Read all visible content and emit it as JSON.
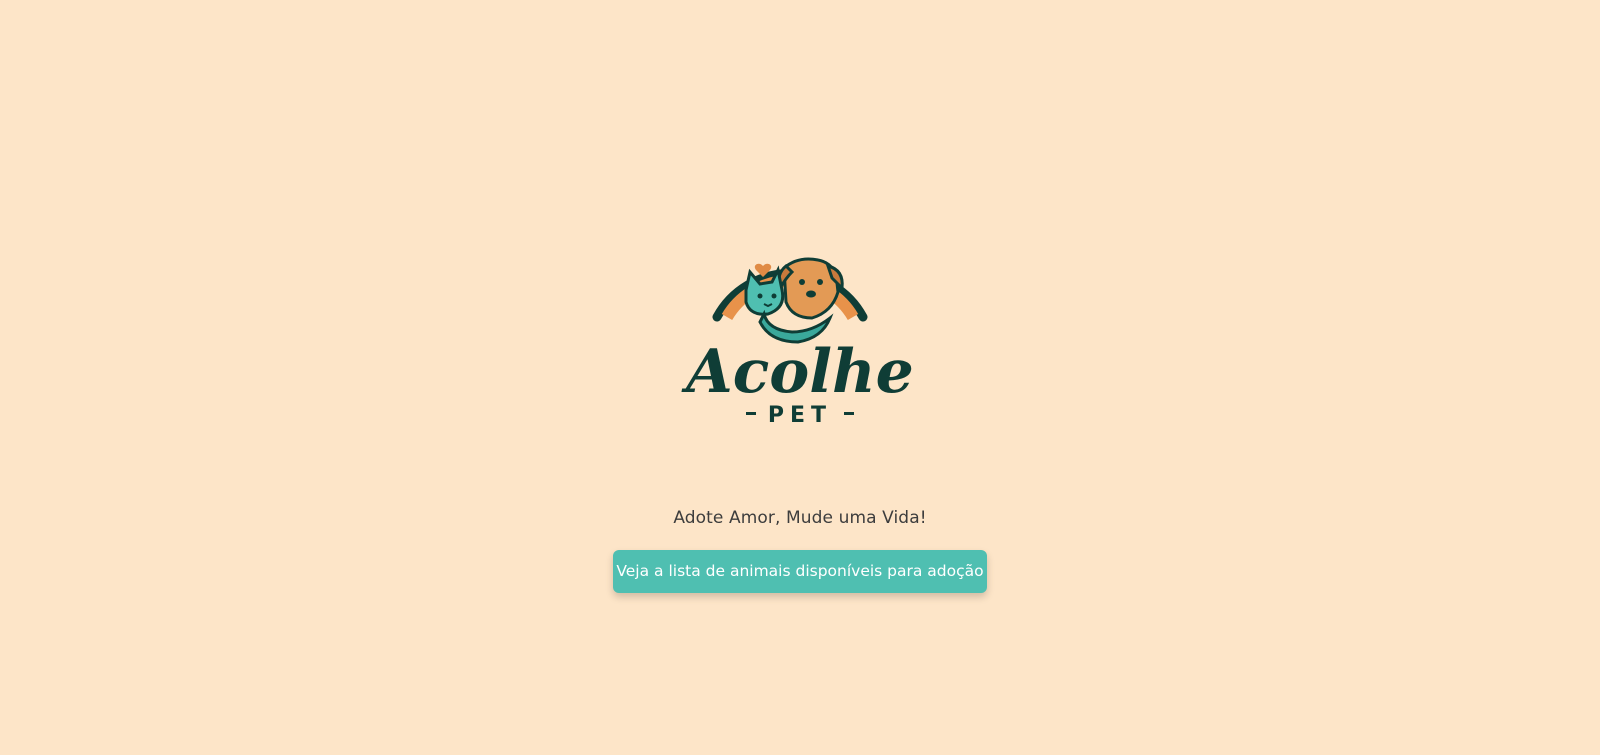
{
  "logo": {
    "brand_name": "Acolhe",
    "brand_subtitle": "PET",
    "colors": {
      "dark_green": "#0f3d36",
      "orange": "#e08b45",
      "teal": "#4fbfb1",
      "tan": "#e39a55"
    }
  },
  "hero": {
    "tagline": "Adote Amor, Mude uma Vida!",
    "cta_label": "Veja a lista de animais disponíveis para adoção"
  },
  "colors": {
    "background": "#fde5c8",
    "button": "#4fbfb1",
    "button_text": "#ffffff",
    "tagline_text": "#3d3d3d"
  }
}
